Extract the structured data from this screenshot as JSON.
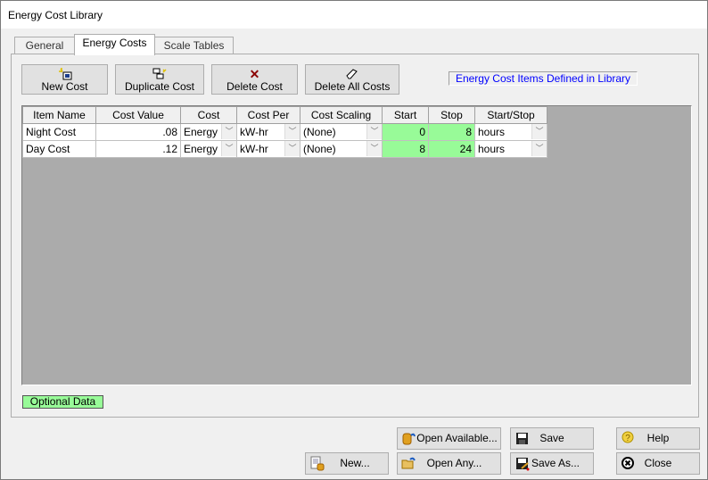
{
  "window": {
    "title": "Energy Cost Library"
  },
  "tabs": [
    {
      "label": "General",
      "active": false
    },
    {
      "label": "Energy Costs",
      "active": true
    },
    {
      "label": "Scale Tables",
      "active": false
    }
  ],
  "toolbar": {
    "new_cost": "New Cost",
    "duplicate_cost": "Duplicate Cost",
    "delete_cost": "Delete Cost",
    "delete_all_costs": "Delete All Costs"
  },
  "info_label": "Energy Cost Items Defined in Library",
  "grid": {
    "columns": [
      "Item Name",
      "Cost Value",
      "Cost",
      "Cost Per",
      "Cost Scaling",
      "Start",
      "Stop",
      "Start/Stop"
    ],
    "rows": [
      {
        "item_name": "Night Cost",
        "cost_value": ".08",
        "cost": "Energy",
        "cost_per": "kW-hr",
        "cost_scaling": "(None)",
        "start": "0",
        "stop": "8",
        "start_stop": "hours"
      },
      {
        "item_name": "Day Cost",
        "cost_value": ".12",
        "cost": "Energy",
        "cost_per": "kW-hr",
        "cost_scaling": "(None)",
        "start": "8",
        "stop": "24",
        "start_stop": "hours"
      }
    ]
  },
  "legend": {
    "optional_data": "Optional Data"
  },
  "footer": {
    "new": "New...",
    "open_available": "Open Available...",
    "open_any": "Open Any...",
    "save": "Save",
    "save_as": "Save As...",
    "help": "Help",
    "close": "Close"
  },
  "colors": {
    "optional_green": "#98fb98",
    "info_text": "#0000ff",
    "grid_bg": "#ababab"
  }
}
